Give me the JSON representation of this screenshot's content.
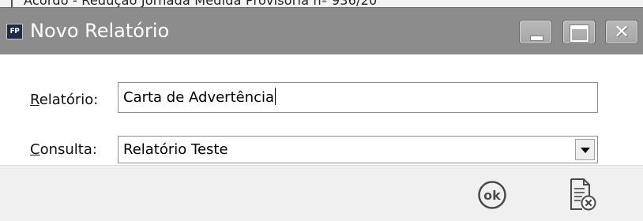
{
  "window": {
    "title": "Novo Relatório",
    "app_icon_text": "FP",
    "close_glyph": "✕"
  },
  "background_window": {
    "partial_text": "Acordo - Redução Jornada Medida Provisória nº 936/20"
  },
  "form": {
    "relatorio": {
      "label_underlined": "R",
      "label_rest": "elatório:",
      "value": "Carta de Advertência"
    },
    "consulta": {
      "label_underlined": "C",
      "label_rest": "onsulta:",
      "selected": "Relatório Teste"
    }
  },
  "footer": {
    "ok_label": "ok"
  },
  "icons": {
    "app": "fp-app-icon",
    "minimize": "minimize-icon",
    "maximize": "maximize-icon",
    "close": "close-icon",
    "dropdown": "chevron-down-icon",
    "ok": "ok-circle-icon",
    "cancel": "document-cancel-icon"
  },
  "colors": {
    "titlebar": "#8c8c8c",
    "title_text": "#ffffff",
    "footer": "#f0f0f0",
    "icon_stroke": "#4a4a4a"
  }
}
